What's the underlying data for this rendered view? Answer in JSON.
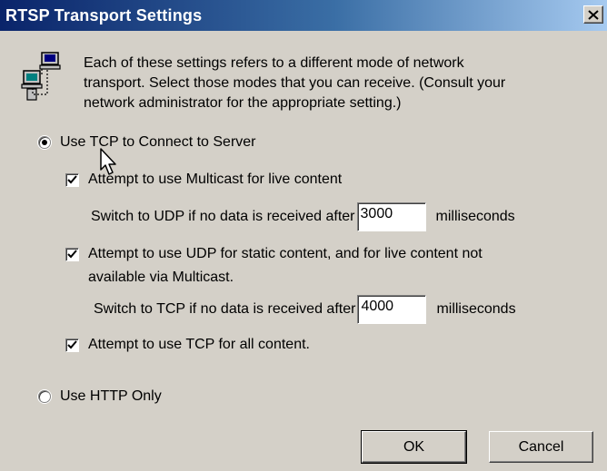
{
  "window": {
    "title": "RTSP Transport Settings",
    "close_symbol": "close-icon"
  },
  "info": {
    "icon": "network-computers-icon",
    "lines": [
      "Each of these settings refers to a different mode of network",
      "transport. Select those modes that you can receive. (Consult your",
      "network administrator for the appropriate setting.)"
    ]
  },
  "options": {
    "use_tcp": {
      "label": "Use TCP to Connect to Server",
      "selected": true
    },
    "multicast": {
      "label": "Attempt to use Multicast for live content",
      "checked": true
    },
    "udp_switch": {
      "prefix": "Switch to UDP if no data is received after",
      "value": "3000",
      "unit": "milliseconds"
    },
    "udp_static": {
      "label_line1": "Attempt to use UDP for static content, and for live content not",
      "label_line2": "available via Multicast.",
      "checked": true
    },
    "tcp_switch": {
      "prefix": "Switch to TCP if no data is received after",
      "value": "4000",
      "unit": "milliseconds"
    },
    "tcp_all": {
      "label": "Attempt to use TCP for all content.",
      "checked": true
    },
    "use_http": {
      "label": "Use HTTP Only",
      "selected": false
    }
  },
  "buttons": {
    "ok": "OK",
    "cancel": "Cancel"
  },
  "colors": {
    "title_start": "#0a246a",
    "title_end": "#a6caf0",
    "face": "#d4d0c8"
  }
}
